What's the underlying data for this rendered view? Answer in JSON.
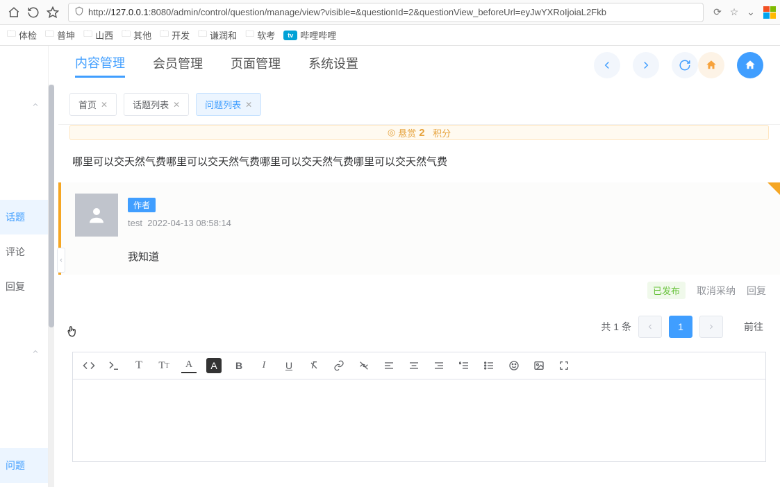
{
  "browser": {
    "url_host": "127.0.0.1",
    "url_prefix": "http://",
    "url_port_path": ":8080/admin/control/question/manage/view?visible=&questionId=2&questionView_beforeUrl=eyJwYXRoIjoiaL2Fkb"
  },
  "bookmarks": [
    "体检",
    "普坤",
    "山西",
    "其他",
    "开发",
    "谦润和",
    "软考"
  ],
  "bili_label": "哔哩哔哩",
  "top_tabs": [
    "内容管理",
    "会员管理",
    "页面管理",
    "系统设置"
  ],
  "side_items": [
    "话题",
    "评论",
    "回复"
  ],
  "side_low": [
    "问题"
  ],
  "view_tabs": [
    {
      "label": "首页"
    },
    {
      "label": "话题列表"
    },
    {
      "label": "问题列表"
    }
  ],
  "reward": {
    "prefix": "悬赏",
    "num": "2",
    "suffix": "积分"
  },
  "question": "哪里可以交天然气费哪里可以交天然气费哪里可以交天然气费哪里可以交天然气费",
  "answer": {
    "author_tag": "作者",
    "user": "test",
    "time": "2022-04-13 08:58:14",
    "content": "我知道",
    "status": "已发布",
    "actions": [
      "取消采纳",
      "回复"
    ]
  },
  "pagination": {
    "total": "共 1 条",
    "page": "1",
    "goto": "前往"
  }
}
